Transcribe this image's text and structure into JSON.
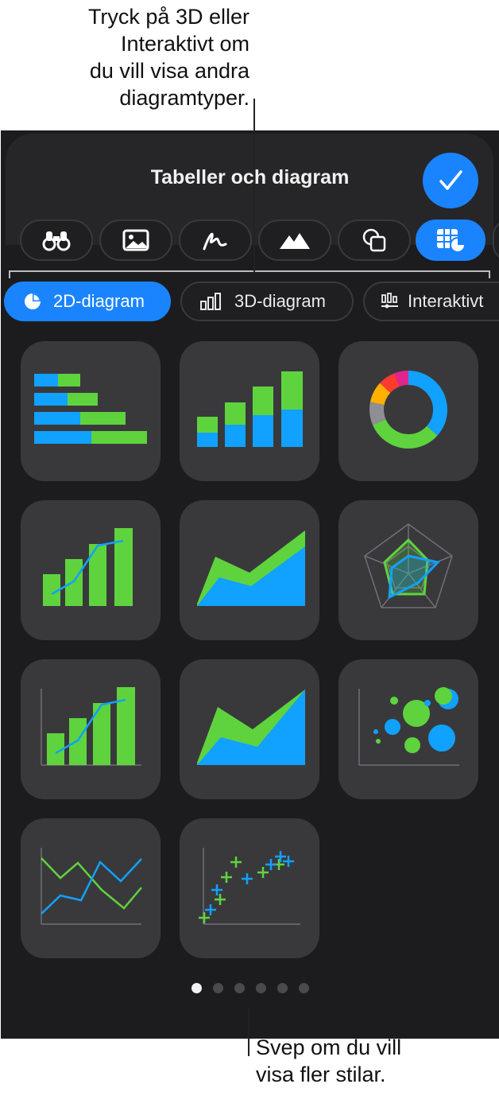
{
  "annotations": {
    "top": [
      "Tryck på 3D eller",
      "Interaktivt om",
      "du vill visa andra",
      "diagramtyper."
    ],
    "bottom": [
      "Svep om du vill",
      "visa fler stilar."
    ]
  },
  "header": {
    "title": "Tabeller och diagram"
  },
  "categories": [
    {
      "icon": "binoculars-icon",
      "selected": false
    },
    {
      "icon": "photo-icon",
      "selected": false
    },
    {
      "icon": "scribble-icon",
      "selected": false
    },
    {
      "icon": "mountains-icon",
      "selected": false
    },
    {
      "icon": "shapes-icon",
      "selected": false
    },
    {
      "icon": "table-chart-icon",
      "selected": true
    }
  ],
  "segments": [
    {
      "label": "2D-diagram",
      "icon": "pie-icon",
      "selected": true
    },
    {
      "label": "3D-diagram",
      "icon": "bars-3d-icon",
      "selected": false
    },
    {
      "label": "Interaktivt",
      "icon": "interactive-icon",
      "selected": false
    }
  ],
  "chart_styles": [
    "stacked-horizontal-bar",
    "stacked-vertical-bar",
    "donut",
    "bar-line",
    "stacked-area",
    "radar",
    "bar-line-axes",
    "area-axes",
    "bubble",
    "line",
    "scatter"
  ],
  "pagination": {
    "pages": 6,
    "current": 1
  },
  "colors": {
    "accent": "#1a84ff",
    "green": "#5fd33e",
    "blue": "#11a1ff"
  }
}
